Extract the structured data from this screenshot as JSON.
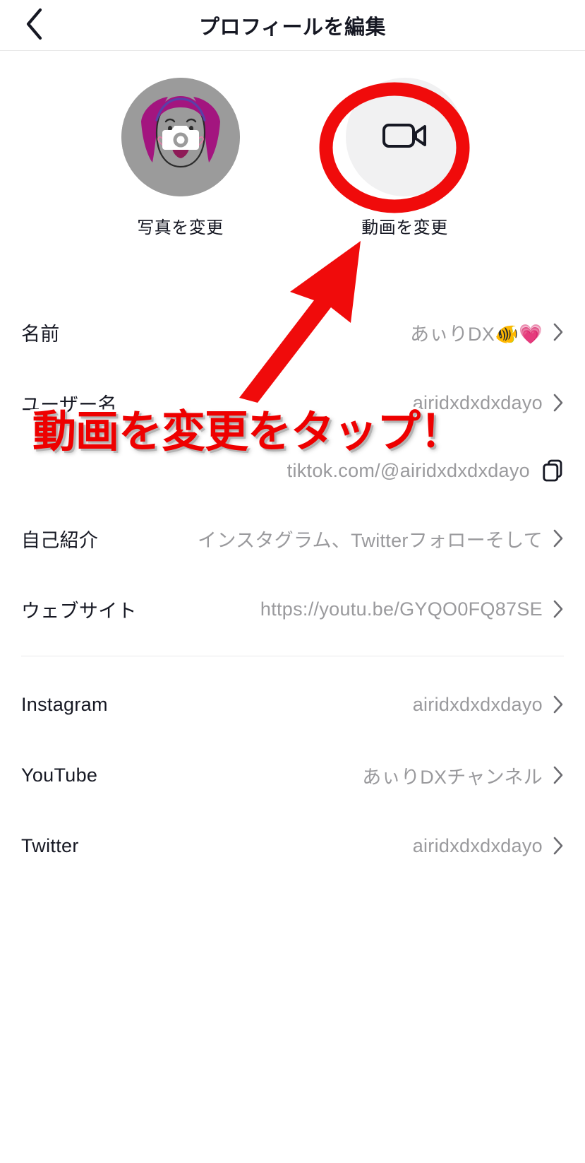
{
  "header": {
    "title": "プロフィールを編集",
    "back_icon": "chevron-left-icon"
  },
  "media": {
    "photo": {
      "label": "写真を変更",
      "icon": "camera-icon",
      "avatar_bg": "#9b9b9b",
      "hair_color": "#a3157f",
      "hair_highlight": "#5b3fa8"
    },
    "video": {
      "label": "動画を変更",
      "icon": "video-camera-icon",
      "circle_bg": "#f1f1f2"
    }
  },
  "fields": [
    {
      "label": "名前",
      "value": "あぃりDX🐠💗",
      "icon": "chevron-right-icon"
    },
    {
      "label": "ユーザー名",
      "value": "airidxdxdxdayo",
      "icon": "chevron-right-icon"
    }
  ],
  "profile_url": {
    "value": "tiktok.com/@airidxdxdxdayo",
    "icon": "copy-icon"
  },
  "details": [
    {
      "label": "自己紹介",
      "value": "インスタグラム、Twitterフォローそして",
      "icon": "chevron-right-icon"
    },
    {
      "label": "ウェブサイト",
      "value": "https://youtu.be/GYQO0FQ87SE",
      "icon": "chevron-right-icon"
    }
  ],
  "socials": [
    {
      "label": "Instagram",
      "value": "airidxdxdxdayo",
      "icon": "chevron-right-icon"
    },
    {
      "label": "YouTube",
      "value": "あぃりDXチャンネル",
      "icon": "chevron-right-icon"
    },
    {
      "label": "Twitter",
      "value": "airidxdxdxdayo",
      "icon": "chevron-right-icon"
    }
  ],
  "annotation": {
    "text": "動画を変更をタップ！",
    "color": "#ee0000",
    "outline_color": "#ffffff",
    "circle_icon": "hand-drawn-circle-highlight",
    "arrow_icon": "red-arrow-icon"
  }
}
